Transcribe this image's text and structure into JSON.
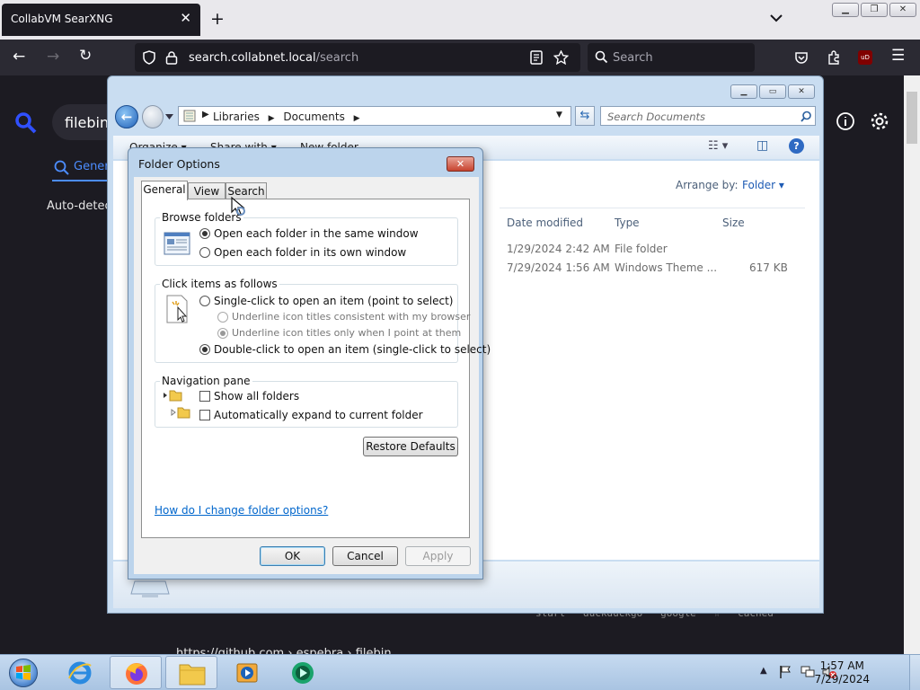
{
  "browser": {
    "tab_title": "CollabVM SearXNG",
    "tab_close": "✕",
    "new_tab": "+",
    "url_host": "search.collabnet.local",
    "url_path": "/search",
    "search_placeholder": "Search",
    "ublock_badge": "uD"
  },
  "searx": {
    "query": "filebin",
    "tab_general": "General",
    "auto_detect": "Auto-detect",
    "result_url": "https://github.com › espebra › filebin",
    "result_snippet": "start · duckduckgo · google · ☆ · cached"
  },
  "explorer": {
    "breadcrumb": [
      "Libraries",
      "Documents"
    ],
    "search_placeholder": "Search Documents",
    "cmd": {
      "organize": "Organize ▾",
      "share": "Share with ▾",
      "new_folder": "New folder"
    },
    "arrange_label": "Arrange by:",
    "arrange_value": "Folder",
    "columns": [
      "Date modified",
      "Type",
      "Size"
    ],
    "rows": [
      {
        "date": "1/29/2024 2:42 AM",
        "type": "File folder",
        "size": ""
      },
      {
        "date": "7/29/2024 1:56 AM",
        "type": "Windows Theme ...",
        "size": "617 KB"
      }
    ]
  },
  "folder_options": {
    "title": "Folder Options",
    "tabs": [
      "General",
      "View",
      "Search"
    ],
    "browse_folders": {
      "title": "Browse folders",
      "options": [
        "Open each folder in the same window",
        "Open each folder in its own window"
      ],
      "selected": 0
    },
    "click_items": {
      "title": "Click items as follows",
      "single": "Single-click to open an item (point to select)",
      "underline_browser": "Underline icon titles consistent with my browser",
      "underline_point": "Underline icon titles only when I point at them",
      "double": "Double-click to open an item (single-click to select)"
    },
    "navigation_pane": {
      "title": "Navigation pane",
      "show_all": "Show all folders",
      "auto_expand": "Automatically expand to current folder"
    },
    "restore_defaults": "Restore Defaults",
    "help_link": "How do I change folder options?",
    "ok": "OK",
    "cancel": "Cancel",
    "apply": "Apply"
  },
  "taskbar": {
    "time": "1:57 AM",
    "date": "7/29/2024"
  },
  "colors": {
    "accent": "#4c8dff",
    "ff_dark": "#1c1b22",
    "win7_frame": "#bcd4ec"
  }
}
